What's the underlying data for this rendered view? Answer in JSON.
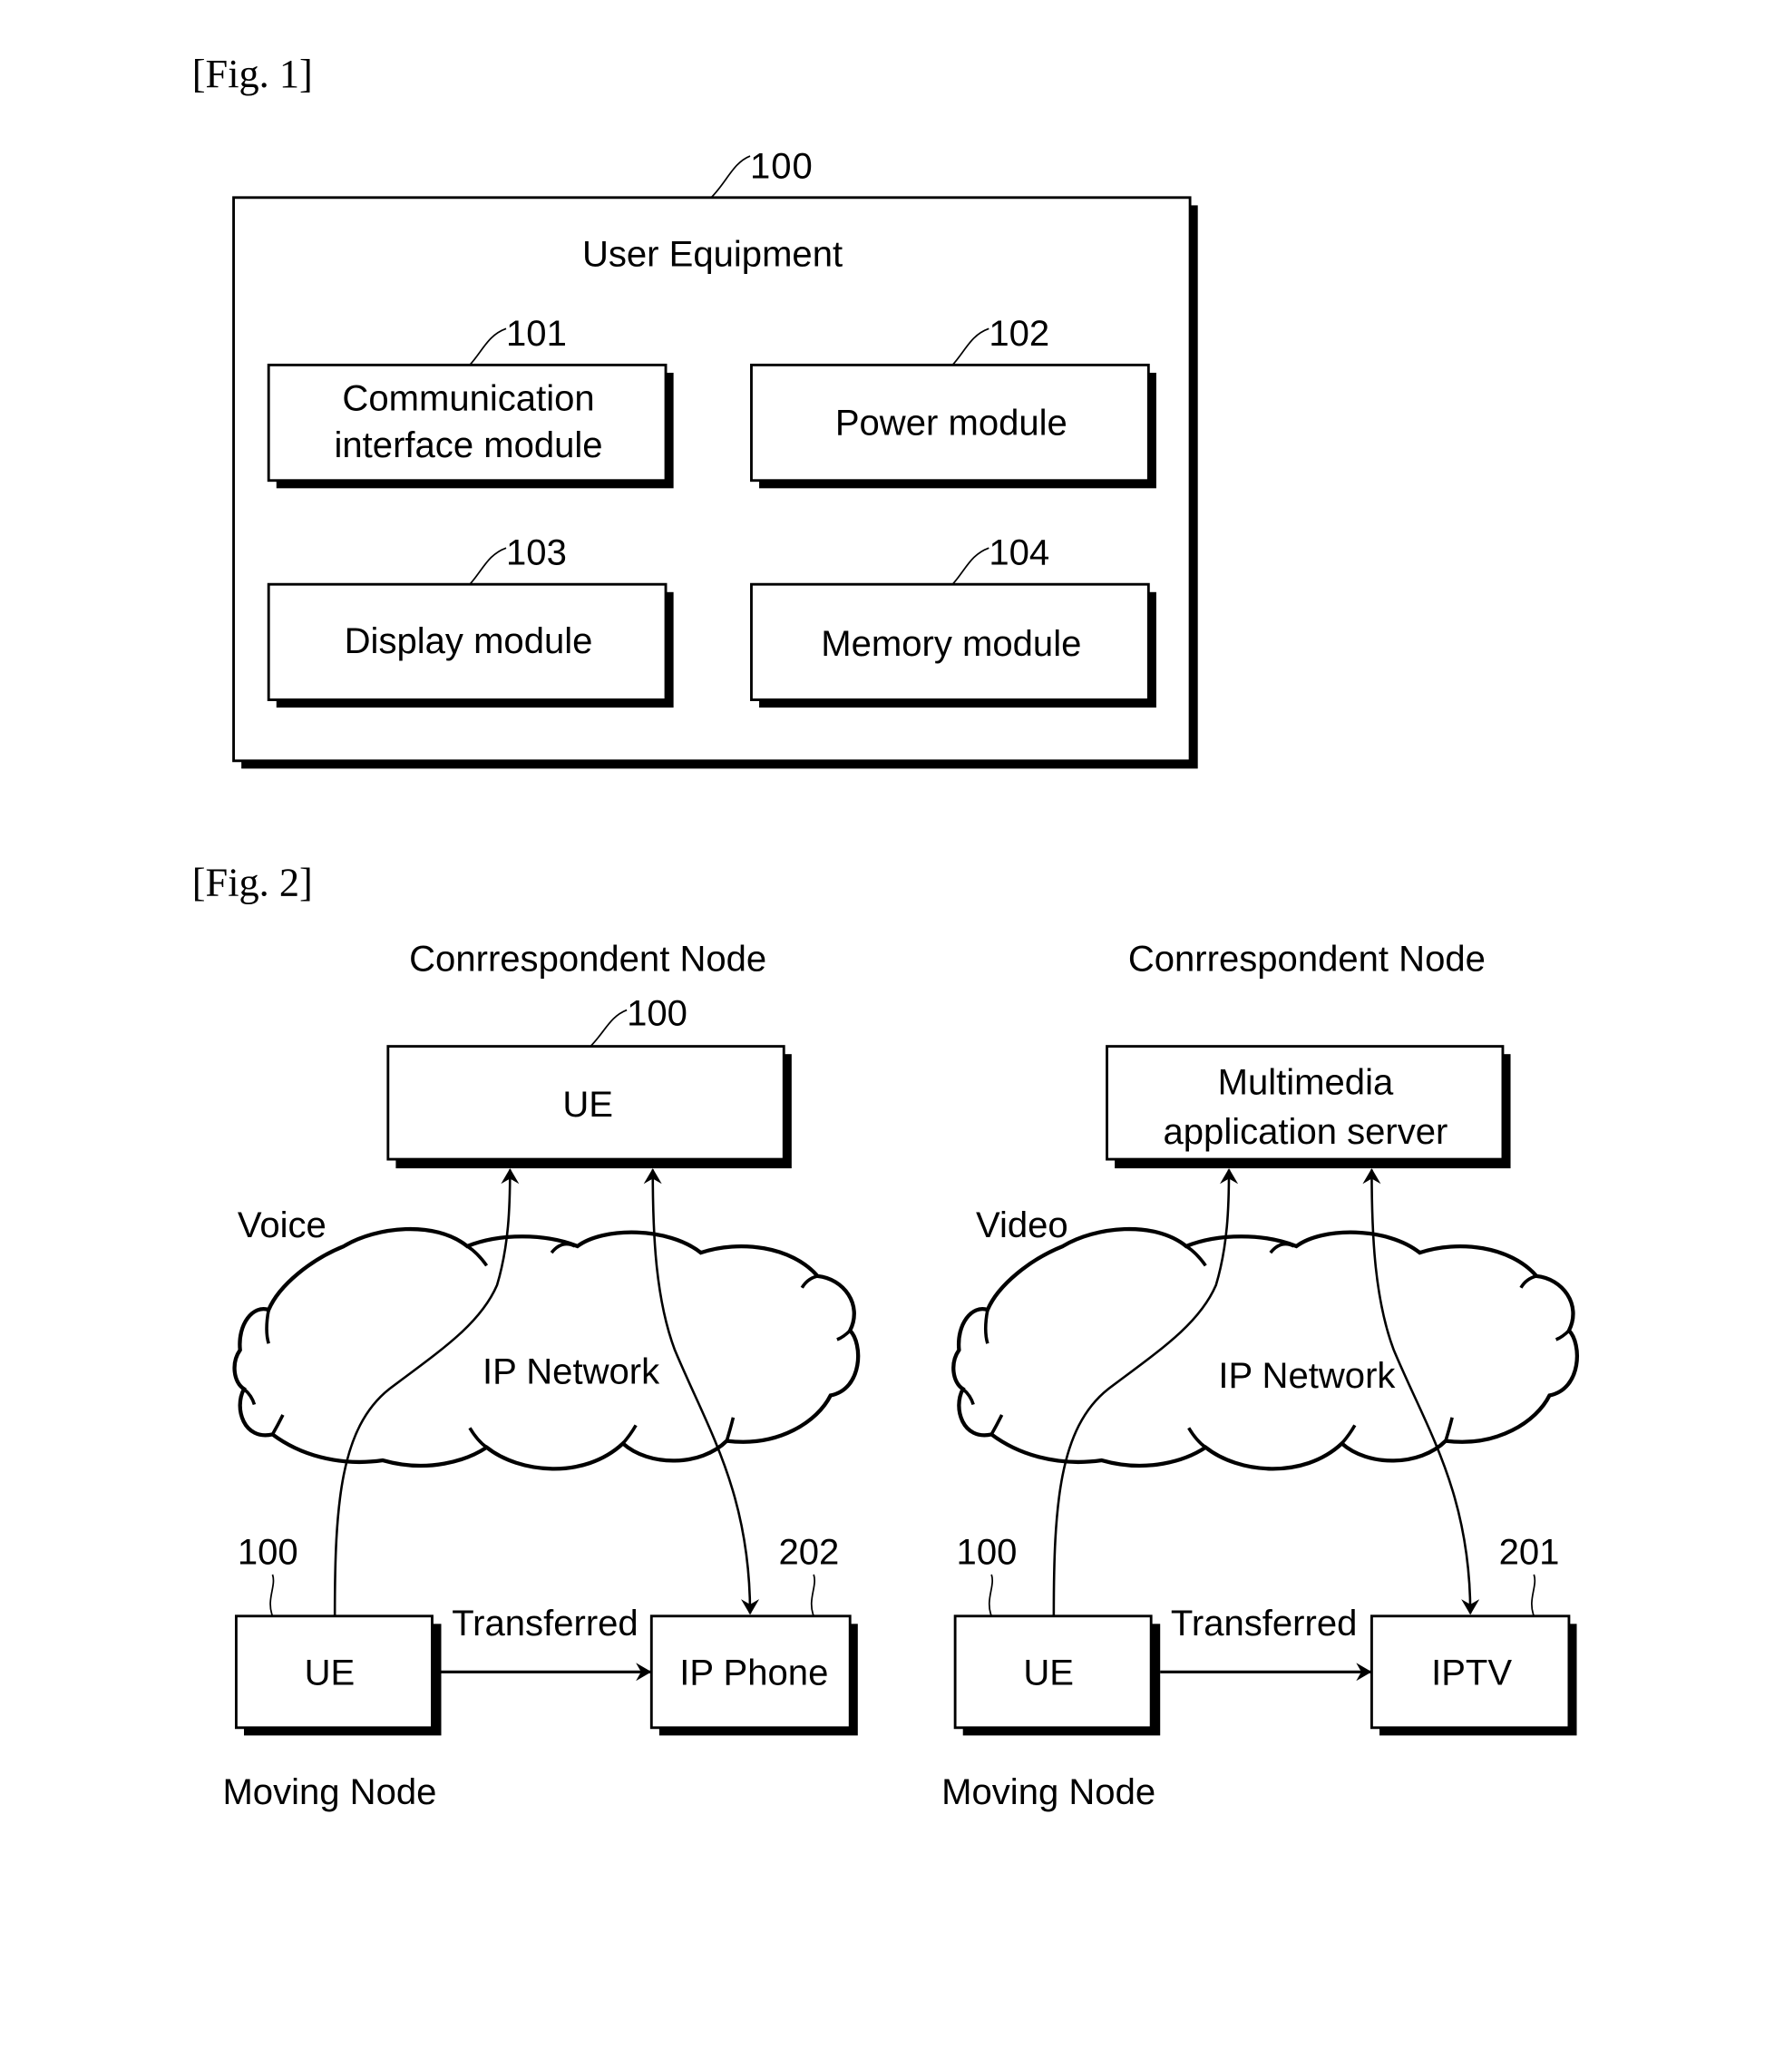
{
  "fig1": {
    "label": "[Fig. 1]",
    "container": {
      "ref": "100",
      "title": "User Equipment"
    },
    "modules": [
      {
        "ref": "101",
        "lines": [
          "Communication",
          "interface module"
        ]
      },
      {
        "ref": "102",
        "lines": [
          "Power module"
        ]
      },
      {
        "ref": "103",
        "lines": [
          "Display module"
        ]
      },
      {
        "ref": "104",
        "lines": [
          "Memory module"
        ]
      }
    ]
  },
  "fig2": {
    "label": "[Fig. 2]",
    "panels": [
      {
        "heading": "Conrrespondent Node",
        "top_node": {
          "ref": "100",
          "lines": [
            "UE"
          ]
        },
        "media": "Voice",
        "network": "IP Network",
        "source": {
          "ref": "100",
          "label": "UE",
          "caption": "Moving Node"
        },
        "transfer_label": "Transferred",
        "target": {
          "ref": "202",
          "label": "IP Phone"
        }
      },
      {
        "heading": "Conrrespondent Node",
        "top_node": {
          "ref": "",
          "lines": [
            "Multimedia",
            "application server"
          ]
        },
        "media": "Video",
        "network": "IP Network",
        "source": {
          "ref": "100",
          "label": "UE",
          "caption": "Moving Node"
        },
        "transfer_label": "Transferred",
        "target": {
          "ref": "201",
          "label": "IPTV"
        }
      }
    ]
  }
}
